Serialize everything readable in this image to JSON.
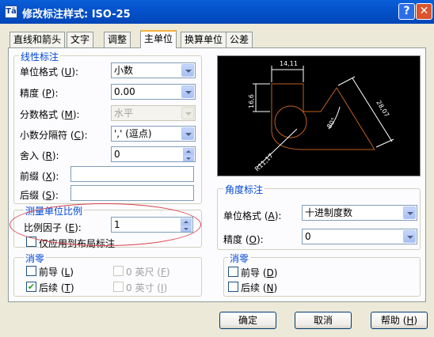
{
  "window": {
    "icon_glyph": "Tā",
    "title": "修改标注样式: ISO-25",
    "help_glyph": "?",
    "close_glyph": "✕"
  },
  "tabs": [
    {
      "label": "直线和箭头",
      "active": false
    },
    {
      "label": "文字",
      "active": false
    },
    {
      "label": "调整",
      "active": false
    },
    {
      "label": "主单位",
      "active": true
    },
    {
      "label": "换算单位",
      "active": false
    },
    {
      "label": "公差",
      "active": false
    }
  ],
  "linear": {
    "title": "线性标注",
    "unit_format": {
      "label": "单位格式",
      "key": "U",
      "value": "小数"
    },
    "precision": {
      "label": "精度",
      "key": "P",
      "value": "0.00"
    },
    "fraction_format": {
      "label": "分数格式",
      "key": "M",
      "value": "水平"
    },
    "decimal_separator": {
      "label": "小数分隔符",
      "key": "C",
      "value": "','  (逗点)"
    },
    "round_off": {
      "label": "舍入",
      "key": "R",
      "value": "0"
    },
    "prefix": {
      "label": "前缀",
      "key": "X",
      "value": ""
    },
    "suffix": {
      "label": "后缀",
      "key": "S",
      "value": ""
    }
  },
  "scale": {
    "title": "测量单位比例",
    "factor": {
      "label": "比例因子",
      "key": "E",
      "value": "1"
    },
    "layout_only": {
      "label": "仅应用到布局标注",
      "checked": false
    }
  },
  "zero_linear": {
    "title": "消零",
    "leading": {
      "label": "前导",
      "key": "L",
      "checked": false
    },
    "trailing": {
      "label": "后续",
      "key": "T",
      "checked": true
    },
    "feet": {
      "label": "0 英尺",
      "key": "F",
      "checked": false
    },
    "inches": {
      "label": "0 英寸",
      "key": "I",
      "checked": false
    }
  },
  "preview": {
    "dim_top": "14,11",
    "dim_left": "16,6",
    "dim_right": "28,07",
    "dim_radius": "R11,17",
    "dim_angle": "80°",
    "line_color": "#c06020",
    "text_color": "#ffffff"
  },
  "angular": {
    "title": "角度标注",
    "unit_format": {
      "label": "单位格式",
      "key": "A",
      "value": "十进制度数"
    },
    "precision": {
      "label": "精度",
      "key": "O",
      "value": "0"
    }
  },
  "zero_angular": {
    "title": "消零",
    "leading": {
      "label": "前导",
      "key": "D",
      "checked": false
    },
    "trailing": {
      "label": "后续",
      "key": "N",
      "checked": false
    }
  },
  "buttons": {
    "ok": {
      "label": "确定"
    },
    "cancel": {
      "label": "取消"
    },
    "help": {
      "label": "帮助",
      "key": "H"
    }
  },
  "colors": {
    "titlebar": "#0350c8",
    "group_title": "#0046d5",
    "highlight": "#d8404a"
  }
}
